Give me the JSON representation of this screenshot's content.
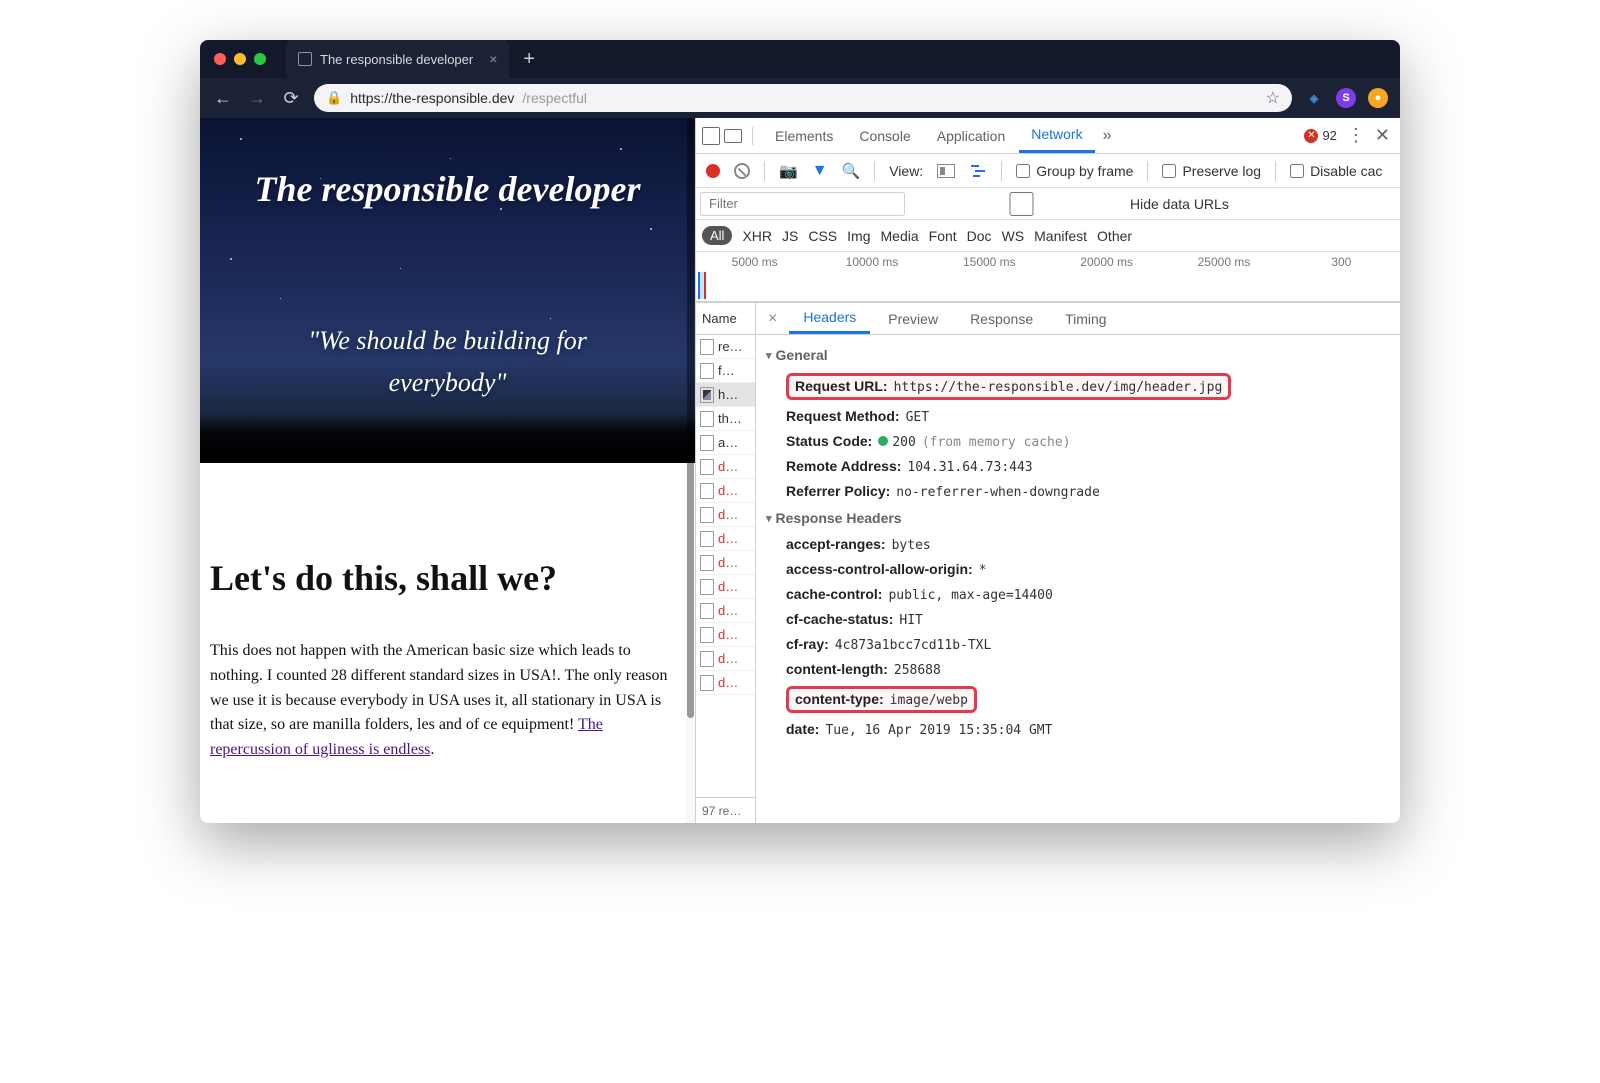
{
  "browser": {
    "tab_title": "The responsible developer",
    "url_host": "https://the-responsible.dev",
    "url_path": "/respectful"
  },
  "page": {
    "hero_title": "The responsible developer",
    "hero_quote_l1": "\"We should be building for",
    "hero_quote_l2": "everybody\"",
    "article_heading": "Let's do this, shall we?",
    "article_body_before_link": "This does not happen with the American basic size which leads to nothing. I counted 28 different standard sizes in USA!. The only reason we use it is because everybody in USA uses it, all stationary in USA is that size, so are manilla folders, les and of ce equipment! ",
    "article_link": "The repercussion of ugliness is endless",
    "article_body_after_link": "."
  },
  "devtools": {
    "tabs": {
      "elements": "Elements",
      "console": "Console",
      "application": "Application",
      "network": "Network"
    },
    "error_count": "92",
    "toolbar": {
      "view": "View:",
      "group_by_frame": "Group by frame",
      "preserve_log": "Preserve log",
      "disable_cache": "Disable cac"
    },
    "filter_placeholder": "Filter",
    "hide_data_urls": "Hide data URLs",
    "types": {
      "all": "All",
      "xhr": "XHR",
      "js": "JS",
      "css": "CSS",
      "img": "Img",
      "media": "Media",
      "font": "Font",
      "doc": "Doc",
      "ws": "WS",
      "manifest": "Manifest",
      "other": "Other"
    },
    "timeline": [
      "5000 ms",
      "10000 ms",
      "15000 ms",
      "20000 ms",
      "25000 ms",
      "300"
    ],
    "name_header": "Name",
    "files": [
      "re…",
      "f…",
      "h…",
      "th…",
      "a…",
      "d…",
      "d…",
      "d…",
      "d…",
      "d…",
      "d…",
      "d…",
      "d…",
      "d…",
      "d…"
    ],
    "footer": "97 re…",
    "det_tabs": {
      "headers": "Headers",
      "preview": "Preview",
      "response": "Response",
      "timing": "Timing"
    },
    "general_label": "General",
    "request_url_k": "Request URL:",
    "request_url_v": "https://the-responsible.dev/img/header.jpg",
    "method_k": "Request Method:",
    "method_v": "GET",
    "status_k": "Status Code:",
    "status_v": "200",
    "status_note": "(from memory cache)",
    "remote_k": "Remote Address:",
    "remote_v": "104.31.64.73:443",
    "referrer_k": "Referrer Policy:",
    "referrer_v": "no-referrer-when-downgrade",
    "resp_hdr_label": "Response Headers",
    "hdrs": [
      {
        "k": "accept-ranges:",
        "v": "bytes"
      },
      {
        "k": "access-control-allow-origin:",
        "v": "*"
      },
      {
        "k": "cache-control:",
        "v": "public, max-age=14400"
      },
      {
        "k": "cf-cache-status:",
        "v": "HIT"
      },
      {
        "k": "cf-ray:",
        "v": "4c873a1bcc7cd11b-TXL"
      },
      {
        "k": "content-length:",
        "v": "258688"
      },
      {
        "k": "content-type:",
        "v": "image/webp"
      },
      {
        "k": "date:",
        "v": "Tue, 16 Apr 2019 15:35:04 GMT"
      }
    ]
  }
}
